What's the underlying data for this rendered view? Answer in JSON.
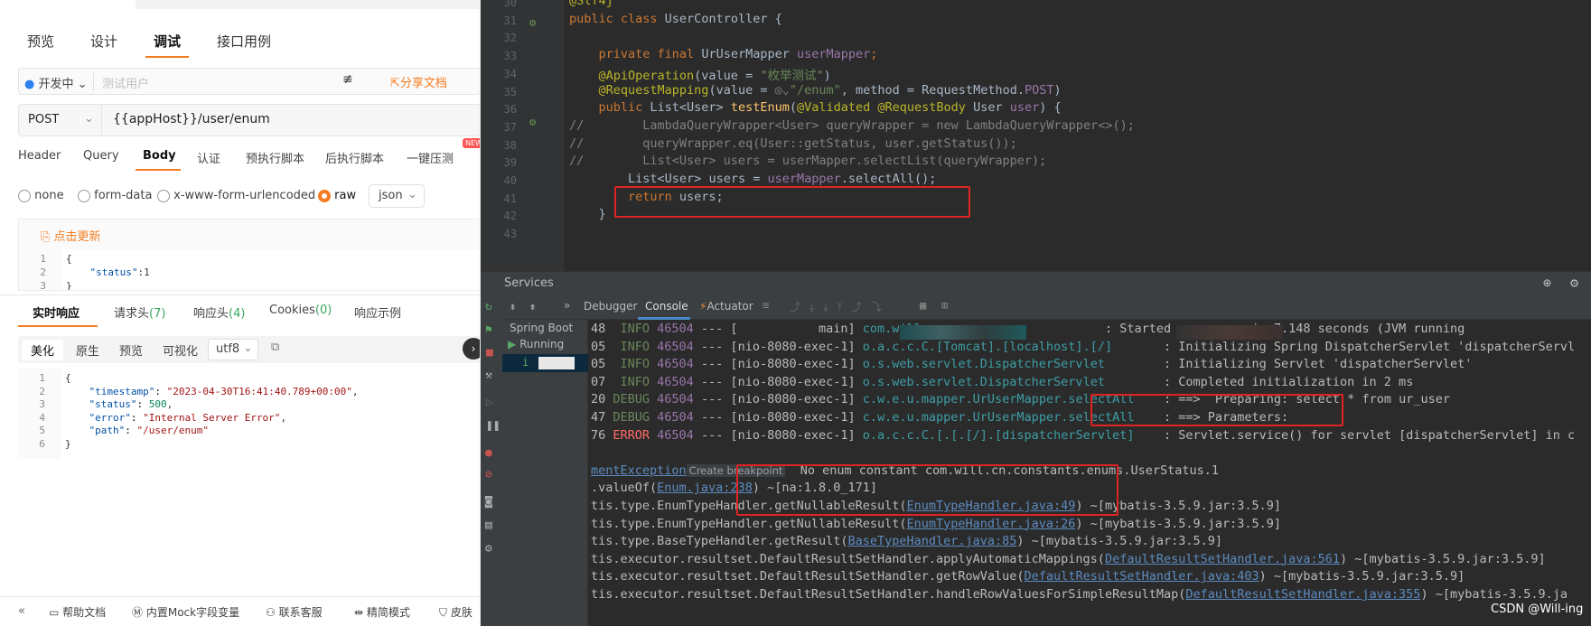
{
  "api": {
    "tabs": [
      "预览",
      "设计",
      "调试",
      "接口用例"
    ],
    "env": "开发中",
    "env_placeholder": "测试用户",
    "share_label": "分享文档",
    "method": "POST",
    "url": "{{appHost}}/user/enum",
    "req_tabs": [
      "Header",
      "Query",
      "Body",
      "认证",
      "预执行脚本",
      "后执行脚本",
      "一键压测"
    ],
    "new_badge": "NEW",
    "body_types": [
      "none",
      "form-data",
      "x-www-form-urlencoded",
      "raw"
    ],
    "format": "json",
    "update_label": "点击更新",
    "req_body": [
      {
        "n": "1",
        "t": "{"
      },
      {
        "n": "2",
        "k": "\"status\"",
        "v": ":1"
      },
      {
        "n": "3",
        "t": "}"
      }
    ],
    "resp_tabs": {
      "realtime": "实时响应",
      "req_headers": "请求头",
      "req_headers_count": "(7)",
      "resp_headers": "响应头",
      "resp_headers_count": "(4)",
      "cookies": "Cookies",
      "cookies_count": "(0)",
      "examples": "响应示例"
    },
    "view_modes": [
      "美化",
      "原生",
      "预览",
      "可视化"
    ],
    "encoding": "utf8",
    "resp_body": [
      {
        "n": "1",
        "t": "{"
      },
      {
        "n": "2",
        "k": "\"timestamp\"",
        "v": "\"2023-04-30T16:41:40.789+00:00\"",
        "c": ","
      },
      {
        "n": "3",
        "k": "\"status\"",
        "num": "500",
        "c": ","
      },
      {
        "n": "4",
        "k": "\"error\"",
        "v": "\"Internal Server Error\"",
        "c": ","
      },
      {
        "n": "5",
        "k": "\"path\"",
        "v": "\"/user/enum\""
      },
      {
        "n": "6",
        "t": "}"
      }
    ],
    "footer": [
      "帮助文档",
      "内置Mock字段变量",
      "联系客服",
      "精简模式",
      "皮肤"
    ]
  },
  "ide": {
    "code": [
      {
        "n": "30",
        "s": [
          [
            "@Slf4j",
            "#bbb529"
          ]
        ]
      },
      {
        "n": "31",
        "s": [
          [
            "public class ",
            "#cc7832"
          ],
          [
            "UserController {",
            "#a9b7c6"
          ]
        ]
      },
      {
        "n": "32",
        "s": []
      },
      {
        "n": "33",
        "s": [
          [
            "    private final ",
            "#cc7832"
          ],
          [
            "UrUserMapper ",
            "#a9b7c6"
          ],
          [
            "userMapper",
            "#9876aa"
          ],
          [
            ";",
            "#cc7832"
          ]
        ]
      },
      {
        "n": "34",
        "s": [
          [
            "    @ApiOperation",
            "#bbb529"
          ],
          [
            "(value = ",
            "#a9b7c6"
          ],
          [
            "\"枚举测试\"",
            "#6a8759"
          ],
          [
            ")",
            "#a9b7c6"
          ]
        ]
      },
      {
        "n": "35",
        "s": [
          [
            "    @RequestMapping",
            "#bbb529"
          ],
          [
            "(value = ",
            "#a9b7c6"
          ],
          [
            "◎⌄",
            "#808080"
          ],
          [
            "\"/enum\"",
            "#6a8759"
          ],
          [
            ", method = RequestMethod.",
            "#a9b7c6"
          ],
          [
            "POST",
            "#9876aa"
          ],
          [
            ")",
            "#a9b7c6"
          ]
        ]
      },
      {
        "n": "36",
        "s": [
          [
            "    public ",
            "#cc7832"
          ],
          [
            "List<User> ",
            "#a9b7c6"
          ],
          [
            "testEnum",
            "#ffc66d"
          ],
          [
            "(",
            "#a9b7c6"
          ],
          [
            "@Validated @RequestBody ",
            "#bbb529"
          ],
          [
            "User ",
            "#a9b7c6"
          ],
          [
            "user",
            "#9876aa"
          ],
          [
            ") {",
            "#a9b7c6"
          ]
        ]
      },
      {
        "n": "37",
        "s": [
          [
            "//        LambdaQueryWrapper<User> queryWrapper = new LambdaQueryWrapper<>();",
            "#808080"
          ]
        ]
      },
      {
        "n": "38",
        "s": [
          [
            "//        queryWrapper.eq(User::getStatus, user.getStatus());",
            "#808080"
          ]
        ]
      },
      {
        "n": "39",
        "s": [
          [
            "//        List<User> users = userMapper.selectList(queryWrapper);",
            "#808080"
          ]
        ]
      },
      {
        "n": "40",
        "s": [
          [
            "        List<User> ",
            "#a9b7c6"
          ],
          [
            "users",
            "#a9b7c6"
          ],
          [
            " = ",
            "#a9b7c6"
          ],
          [
            "userMapper",
            "#9876aa"
          ],
          [
            ".selectAll();",
            "#a9b7c6"
          ]
        ]
      },
      {
        "n": "41",
        "s": [
          [
            "        return ",
            "#cc7832"
          ],
          [
            "users;",
            "#a9b7c6"
          ]
        ]
      },
      {
        "n": "42",
        "s": [
          [
            "    }",
            "#a9b7c6"
          ]
        ]
      },
      {
        "n": "43",
        "s": []
      }
    ],
    "services_label": "Services",
    "console_tabs": [
      "Debugger",
      "Console",
      "Actuator"
    ],
    "tree": {
      "spring_boot": "Spring Boot",
      "running": "Running",
      "app_glyph": "i"
    },
    "console": [
      [
        [
          "48  ",
          "#bbb"
        ],
        [
          "INFO ",
          "#6a8759"
        ],
        [
          "46504",
          "#9876aa"
        ],
        [
          " --- [           main] ",
          "#bbb"
        ],
        [
          "com.will",
          "#3d9ea6"
        ],
        [
          "                         : Started ",
          "#bbb"
        ],
        [
          "          ",
          "#bbb"
        ],
        [
          "in 7.148 seconds (JVM running",
          "#bbb"
        ]
      ],
      [
        [
          "05  ",
          "#bbb"
        ],
        [
          "INFO ",
          "#6a8759"
        ],
        [
          "46504",
          "#9876aa"
        ],
        [
          " --- [nio-8080-exec-1] ",
          "#bbb"
        ],
        [
          "o.a.c.c.C.[Tomcat].[localhost].[/]",
          "#3d9ea6"
        ],
        [
          "       : Initializing Spring DispatcherServlet 'dispatcherServl",
          "#bbb"
        ]
      ],
      [
        [
          "05  ",
          "#bbb"
        ],
        [
          "INFO ",
          "#6a8759"
        ],
        [
          "46504",
          "#9876aa"
        ],
        [
          " --- [nio-8080-exec-1] ",
          "#bbb"
        ],
        [
          "o.s.web.servlet.DispatcherServlet",
          "#3d9ea6"
        ],
        [
          "        : Initializing Servlet 'dispatcherServlet'",
          "#bbb"
        ]
      ],
      [
        [
          "07  ",
          "#bbb"
        ],
        [
          "INFO ",
          "#6a8759"
        ],
        [
          "46504",
          "#9876aa"
        ],
        [
          " --- [nio-8080-exec-1] ",
          "#bbb"
        ],
        [
          "o.s.web.servlet.DispatcherServlet",
          "#3d9ea6"
        ],
        [
          "        : Completed initialization in 2 ms",
          "#bbb"
        ]
      ],
      [
        [
          "20 ",
          "#bbb"
        ],
        [
          "DEBUG ",
          "#6a8759"
        ],
        [
          "46504",
          "#9876aa"
        ],
        [
          " --- [nio-8080-exec-1] ",
          "#bbb"
        ],
        [
          "c.w.e.u.mapper.UrUserMapper.selectAll",
          "#3d9ea6"
        ],
        [
          "    : ==>  Preparing: select * from ur_user",
          "#bbb"
        ]
      ],
      [
        [
          "47 ",
          "#bbb"
        ],
        [
          "DEBUG ",
          "#6a8759"
        ],
        [
          "46504",
          "#9876aa"
        ],
        [
          " --- [nio-8080-exec-1] ",
          "#bbb"
        ],
        [
          "c.w.e.u.mapper.UrUserMapper.selectAll",
          "#3d9ea6"
        ],
        [
          "    : ==> Parameters: ",
          "#bbb"
        ]
      ],
      [
        [
          "76 ",
          "#bbb"
        ],
        [
          "ERROR ",
          "#ff6b68"
        ],
        [
          "46504",
          "#9876aa"
        ],
        [
          " --- [nio-8080-exec-1] ",
          "#bbb"
        ],
        [
          "o.a.c.c.C.[.[.[/].[dispatcherServlet]",
          "#3d9ea6"
        ],
        [
          "    : Servlet.service() for servlet [dispatcherServlet] in c",
          "#bbb"
        ]
      ],
      [],
      [
        [
          "mentException",
          "#5c8bbf"
        ],
        [
          "Create breakpoint",
          "#9aa0a6"
        ],
        [
          "  No enum constant com.will.cn.constants.enums.UserStatus.1",
          "#bbb"
        ]
      ],
      [
        [
          ".valueOf(",
          "#bbb"
        ],
        [
          "Enum.java:238",
          "#5c8bbf"
        ],
        [
          ") ~[na",
          "#bbb"
        ],
        [
          ":1.8.0_171]",
          "#bbb"
        ]
      ],
      [
        [
          "tis.type.EnumTypeHandler.getNullableResult(",
          "#bbb"
        ],
        [
          "EnumTypeHandler.java:49",
          "#5c8bbf"
        ],
        [
          ") ~[mybatis-3.5.9.jar:3.5.9]",
          "#bbb"
        ]
      ],
      [
        [
          "tis.type.EnumTypeHandler.getNullableResult(",
          "#bbb"
        ],
        [
          "EnumTypeHandler.java:26",
          "#5c8bbf"
        ],
        [
          ") ~[mybatis-3.5.9.jar:3.5.9]",
          "#bbb"
        ]
      ],
      [
        [
          "tis.type.BaseTypeHandler.getResult(",
          "#bbb"
        ],
        [
          "BaseTypeHandler.java:85",
          "#5c8bbf"
        ],
        [
          ") ~[mybatis-3.5.9.jar:3.5.9]",
          "#bbb"
        ]
      ],
      [
        [
          "tis.executor.resultset.DefaultResultSetHandler.applyAutomaticMappings(",
          "#bbb"
        ],
        [
          "DefaultResultSetHandler.java:561",
          "#5c8bbf"
        ],
        [
          ") ~[mybatis-3.5.9.jar:3.5.9]",
          "#bbb"
        ]
      ],
      [
        [
          "tis.executor.resultset.DefaultResultSetHandler.getRowValue(",
          "#bbb"
        ],
        [
          "DefaultResultSetHandler.java:403",
          "#5c8bbf"
        ],
        [
          ") ~[mybatis-3.5.9.jar:3.5.9]",
          "#bbb"
        ]
      ],
      [
        [
          "tis.executor.resultset.DefaultResultSetHandler.handleRowValuesForSimpleResultMap(",
          "#bbb"
        ],
        [
          "DefaultResultSetHandler.java:355",
          "#5c8bbf"
        ],
        [
          ") ~[mybatis-3.5.9.ja",
          "#bbb"
        ]
      ]
    ],
    "watermark": "CSDN @Will-ing"
  }
}
